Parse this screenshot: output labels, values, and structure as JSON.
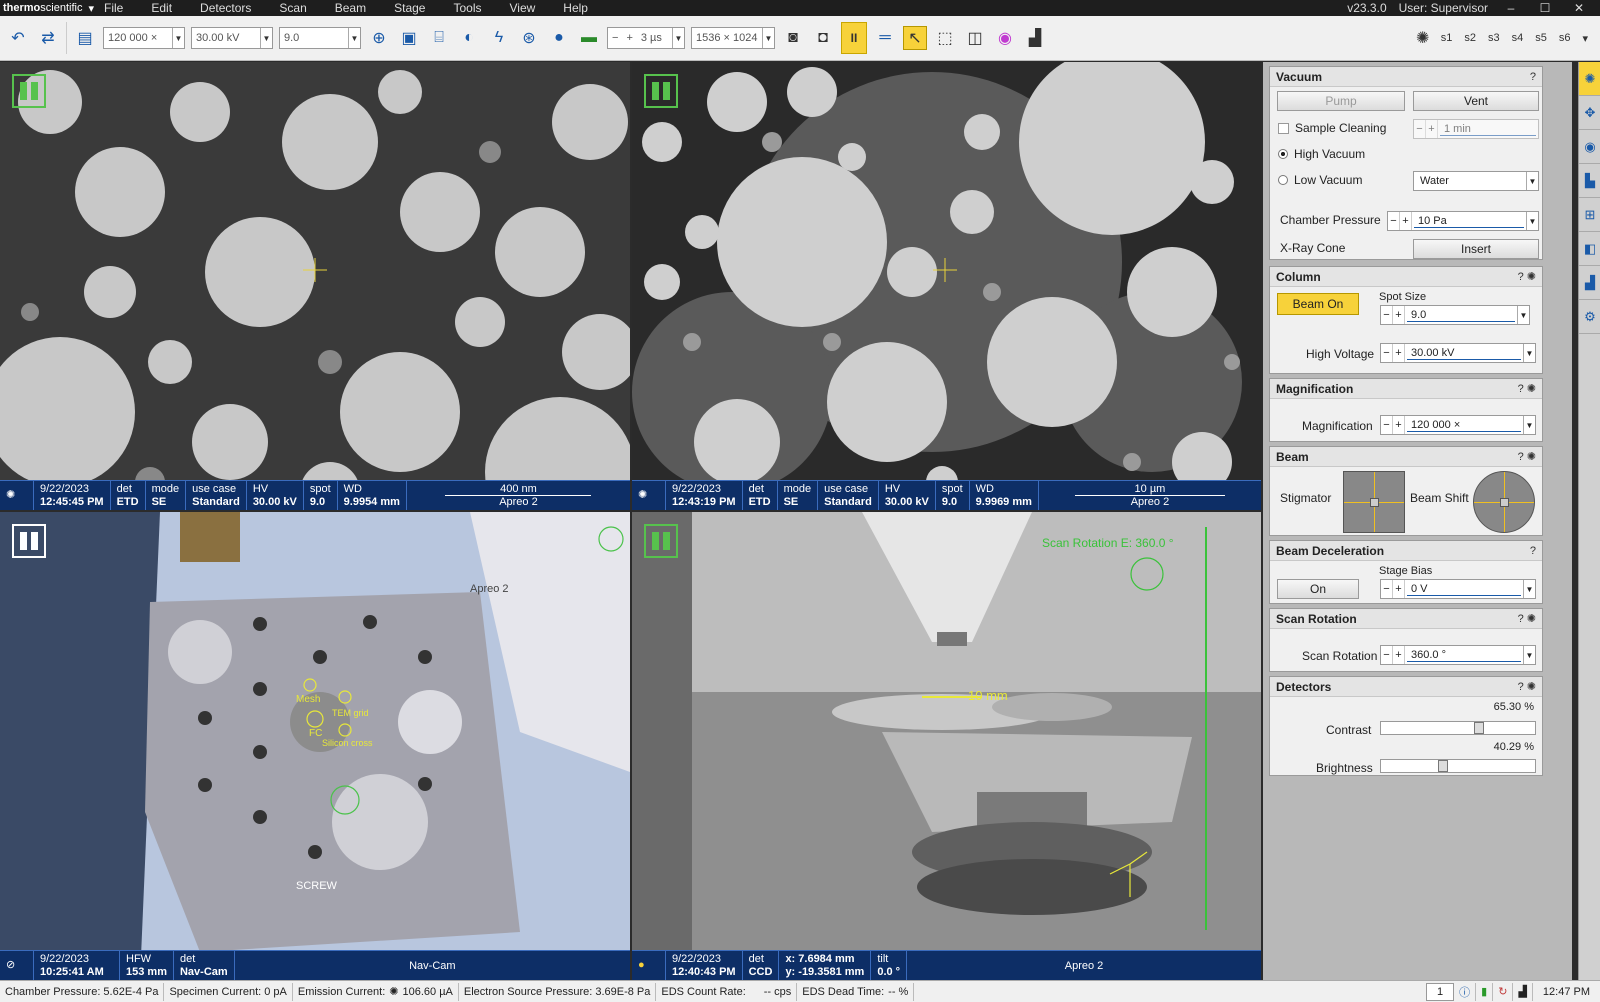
{
  "titlebar": {
    "brand_bold": "thermo",
    "brand": "scientific",
    "menu": [
      "File",
      "Edit",
      "Detectors",
      "Scan",
      "Beam",
      "Stage",
      "Tools",
      "View",
      "Help"
    ],
    "version": "v23.3.0",
    "user": "User: Supervisor"
  },
  "toolbar": {
    "magnification": "120 000 ×",
    "voltage": "30.00 kV",
    "spot": "9.0",
    "dwell": "3 µs",
    "resolution": "1536 × 1024",
    "slots": [
      "s1",
      "s2",
      "s3",
      "s4",
      "s5",
      "s6"
    ]
  },
  "quads": [
    {
      "date": "9/22/2023",
      "time": "12:45:45 PM",
      "det": "ETD",
      "mode": "SE",
      "usecase": "Standard",
      "hv": "30.00 kV",
      "spot": "9.0",
      "wd": "9.9954 mm",
      "scale": "400 nm",
      "instrument": "Apreo 2",
      "labels": {
        "date": "",
        "det": "det",
        "mode": "mode",
        "usecase": "use case",
        "hv": "HV",
        "spot": "spot",
        "wd": "WD"
      }
    },
    {
      "date": "9/22/2023",
      "time": "12:43:19 PM",
      "det": "ETD",
      "mode": "SE",
      "usecase": "Standard",
      "hv": "30.00 kV",
      "spot": "9.0",
      "wd": "9.9969 mm",
      "scale": "10 µm",
      "instrument": "Apreo 2"
    },
    {
      "date": "9/22/2023",
      "time": "10:25:41 AM",
      "hfw_label": "HFW",
      "hfw": "153 mm",
      "det": "Nav-Cam",
      "title": "Nav-Cam",
      "labels": [
        "Mesh",
        "FC",
        "Silicon cross",
        "TEM grid",
        "SCREW"
      ]
    },
    {
      "date": "9/22/2023",
      "time": "12:40:43 PM",
      "det": "CCD",
      "x": "x: 7.6984 mm",
      "y": "y: -19.3581 mm",
      "tilt": "0.0 °",
      "instrument": "Apreo 2",
      "overlay": "Scan Rotation E: 360.0 °",
      "marker": "10 mm"
    }
  ],
  "panel": {
    "vacuum": {
      "title": "Vacuum",
      "pump": "Pump",
      "vent": "Vent",
      "cleaning": "Sample Cleaning",
      "cleaning_time": "1 min",
      "high": "High Vacuum",
      "low": "Low Vacuum",
      "gas": "Water",
      "pressure_label": "Chamber Pressure",
      "pressure": "10 Pa",
      "xray_label": "X-Ray Cone",
      "insert": "Insert"
    },
    "column": {
      "title": "Column",
      "beam_on": "Beam On",
      "spot_label": "Spot Size",
      "spot": "9.0",
      "hv_label": "High Voltage",
      "hv": "30.00 kV"
    },
    "magnification": {
      "title": "Magnification",
      "label": "Magnification",
      "value": "120 000 ×"
    },
    "beam": {
      "title": "Beam",
      "stig": "Stigmator",
      "shift": "Beam Shift"
    },
    "decel": {
      "title": "Beam Deceleration",
      "on": "On",
      "bias_label": "Stage Bias",
      "bias": "0 V"
    },
    "rotation": {
      "title": "Scan Rotation",
      "label": "Scan Rotation",
      "value": "360.0 °"
    },
    "detectors": {
      "title": "Detectors",
      "contrast_label": "Contrast",
      "contrast": "65.30 %",
      "contrast_level": 65.3,
      "brightness_label": "Brightness",
      "brightness": "40.29 %",
      "brightness_level": 40.29
    }
  },
  "status": {
    "chamber": "Chamber Pressure: 5.62E-4 Pa",
    "specimen": "Specimen Current:  0 pA",
    "emission": "Emission Current:",
    "emission_val": "106.60 µA",
    "source": "Electron Source Pressure: 3.69E-8 Pa",
    "eds_rate": "EDS Count Rate:",
    "eds_rate_val": "-- cps",
    "eds_dead": "EDS Dead Time:",
    "eds_dead_val": "-- %",
    "page": "1",
    "clock": "12:47 PM"
  }
}
